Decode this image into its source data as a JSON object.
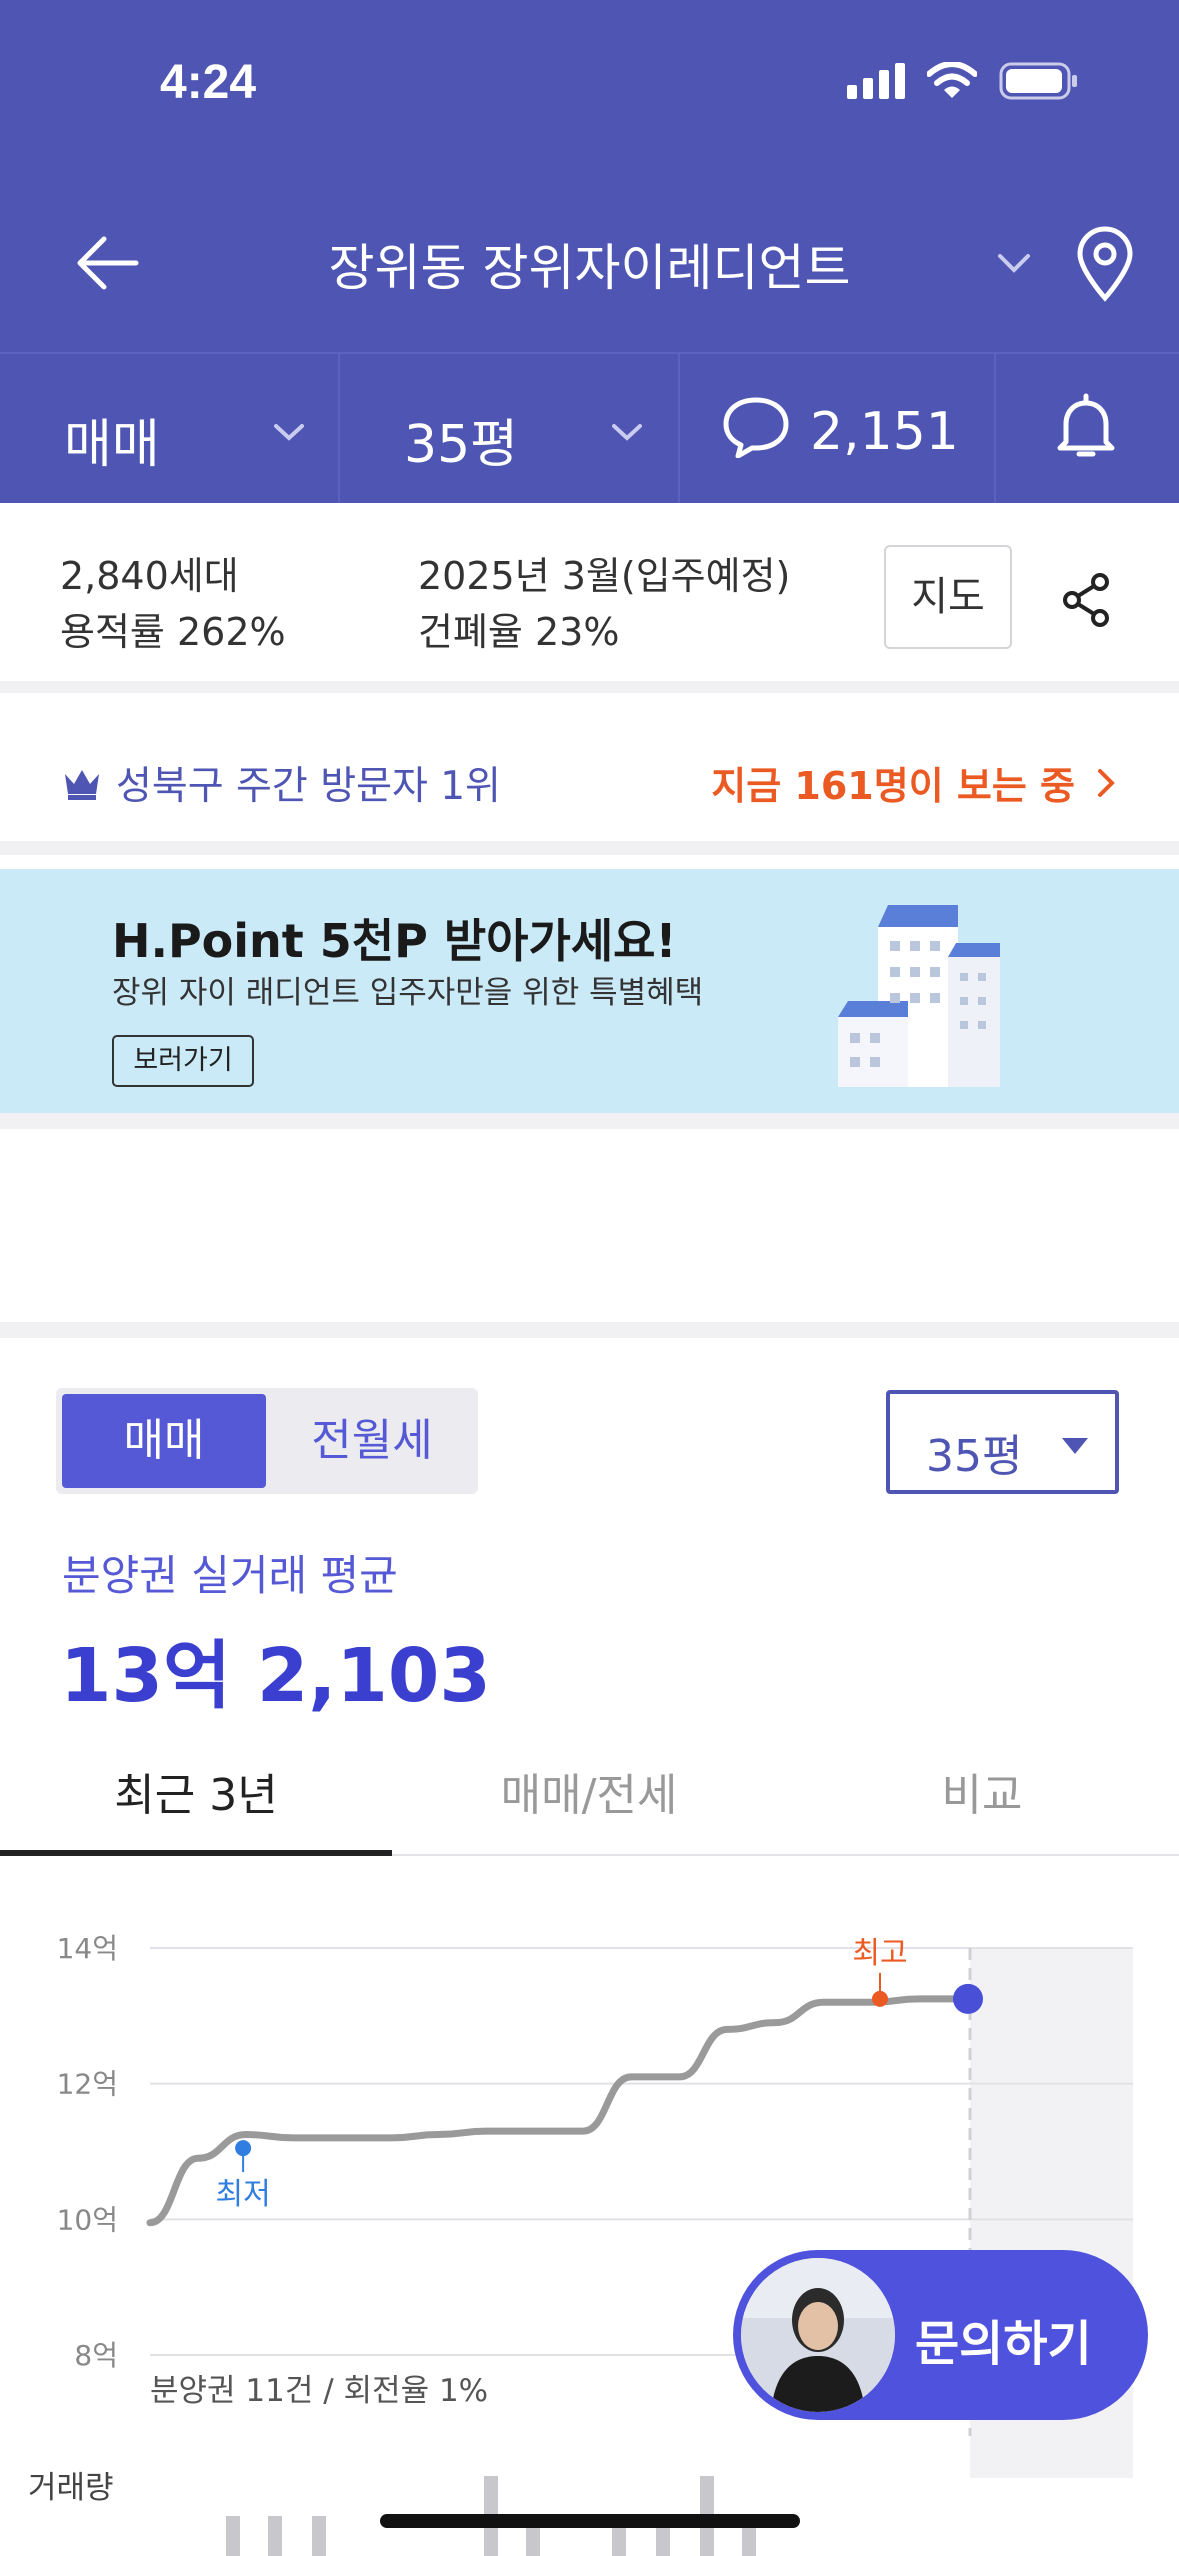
{
  "status_bar": {
    "time": "4:24"
  },
  "header": {
    "title": "장위동 장위자이레디언트"
  },
  "tabbar": {
    "trade_type": "매매",
    "size": "35평",
    "comment_count": "2,151"
  },
  "info": {
    "households": "2,840세대",
    "move_in": "2025년 3월(입주예정)",
    "floor_area_ratio": "용적률 262%",
    "building_coverage": "건폐율 23%",
    "map_button": "지도"
  },
  "rank": {
    "label": "성북구 주간 방문자 1위",
    "viewers": "지금 161명이 보는 중"
  },
  "banner": {
    "headline": "H.Point 5천P 받아가세요!",
    "subtext": "장위 자이 래디언트 입주자만을 위한 특별혜택",
    "button": "보러가기"
  },
  "trade": {
    "seg_active": "매매",
    "seg_inactive": "전월세",
    "size_select": "35평",
    "avg_label": "분양권 실거래 평균",
    "avg_value": "13억 2,103"
  },
  "tabs": [
    "최근 3년",
    "매매/전세",
    "비교"
  ],
  "chart_data": {
    "type": "line",
    "y_ticks": [
      "14억",
      "12억",
      "10억",
      "8억"
    ],
    "ylim": [
      8,
      14
    ],
    "series": [
      {
        "values": [
          9.95,
          10.9,
          11.25,
          11.2,
          11.2,
          11.2,
          11.25,
          11.3,
          11.3,
          11.3,
          12.1,
          12.1,
          12.8,
          12.9,
          13.2,
          13.2,
          13.25,
          13.25
        ]
      }
    ],
    "min_label": "최저",
    "max_label": "최고",
    "note": "분양권 11건 / 회전율 1%",
    "volume_label": "거래량",
    "volume": [
      0,
      1,
      1,
      1,
      0,
      0,
      0,
      2,
      1,
      0,
      1,
      1,
      2,
      1,
      0,
      0
    ]
  },
  "inquiry": {
    "label": "문의하기"
  }
}
